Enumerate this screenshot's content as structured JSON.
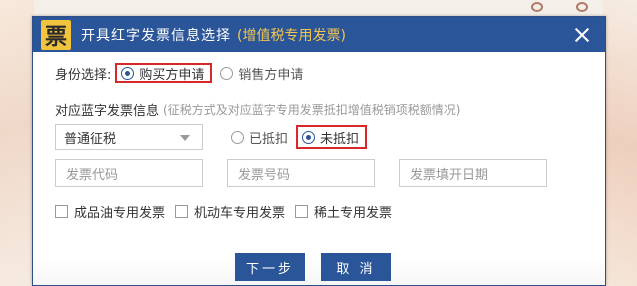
{
  "dialog": {
    "logo_char": "票",
    "title": "开具红字发票信息选择",
    "title_sub": "(增值税专用发票)"
  },
  "identity": {
    "label": "身份选择:",
    "options": [
      "购买方申请",
      "销售方申请"
    ],
    "selected": "购买方申请"
  },
  "blue_invoice": {
    "label": "对应蓝字发票信息",
    "hint": "(征税方式及对应蓝字专用发票抵扣增值税销项税额情况)",
    "tax_method": "普通征税",
    "deduct_options": [
      "已抵扣",
      "未抵扣"
    ],
    "deduct_selected": "未抵扣"
  },
  "fields": {
    "invoice_code_placeholder": "发票代码",
    "invoice_number_placeholder": "发票号码",
    "invoice_date_placeholder": "发票填开日期"
  },
  "checkboxes": [
    "成品油专用发票",
    "机动车专用发票",
    "稀土专用发票"
  ],
  "buttons": {
    "next": "下一步",
    "cancel": "取 消"
  },
  "colors": {
    "titlebar": "#2a5598",
    "title_sub": "#f5c64a",
    "highlight_box": "#d8282a",
    "button": "#2a5598"
  }
}
